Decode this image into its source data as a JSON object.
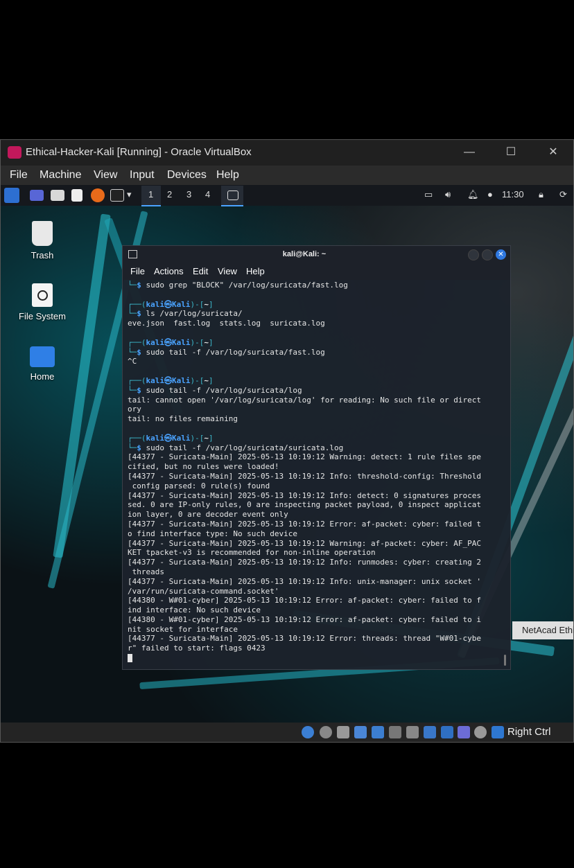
{
  "vbox": {
    "title": "Ethical-Hacker-Kali [Running] - Oracle VirtualBox",
    "menu": [
      "File",
      "Machine",
      "View",
      "Input",
      "Devices",
      "Help"
    ],
    "host_key": "Right Ctrl"
  },
  "panel": {
    "workspaces": [
      "1",
      "2",
      "3",
      "4"
    ],
    "clock": "11:30"
  },
  "desktop": {
    "icons": [
      {
        "label": "Trash",
        "icon": "trash-icon"
      },
      {
        "label": "File System",
        "icon": "drive-icon"
      },
      {
        "label": "Home",
        "icon": "home-folder-icon"
      }
    ],
    "background_text": "NetAcad Ethi"
  },
  "terminal": {
    "title": "kali@Kali: ~",
    "menu": [
      "File",
      "Actions",
      "Edit",
      "View",
      "Help"
    ],
    "prompt_user": "kali",
    "prompt_at": "㉿",
    "prompt_host": "Kali",
    "prompt_dir": "~",
    "lines": [
      {
        "t": "cmd",
        "text": "sudo grep \"BLOCK\" /var/log/suricata/fast.log"
      },
      {
        "t": "blank",
        "text": ""
      },
      {
        "t": "prompt",
        "text": ""
      },
      {
        "t": "cmd",
        "text": "ls /var/log/suricata/"
      },
      {
        "t": "out",
        "text": "eve.json  fast.log  stats.log  suricata.log"
      },
      {
        "t": "blank",
        "text": ""
      },
      {
        "t": "prompt",
        "text": ""
      },
      {
        "t": "cmd",
        "text": "sudo tail -f /var/log/suricata/fast.log"
      },
      {
        "t": "out",
        "text": "^C"
      },
      {
        "t": "blank",
        "text": ""
      },
      {
        "t": "prompt",
        "text": ""
      },
      {
        "t": "cmd",
        "text": "sudo tail -f /var/log/suricata/log"
      },
      {
        "t": "out",
        "text": "tail: cannot open '/var/log/suricata/log' for reading: No such file or direct"
      },
      {
        "t": "out",
        "text": "ory"
      },
      {
        "t": "out",
        "text": "tail: no files remaining"
      },
      {
        "t": "blank",
        "text": ""
      },
      {
        "t": "prompt",
        "text": ""
      },
      {
        "t": "cmd",
        "text": "sudo tail -f /var/log/suricata/suricata.log"
      },
      {
        "t": "out",
        "text": "[44377 - Suricata-Main] 2025-05-13 10:19:12 Warning: detect: 1 rule files spe"
      },
      {
        "t": "out",
        "text": "cified, but no rules were loaded!"
      },
      {
        "t": "out",
        "text": "[44377 - Suricata-Main] 2025-05-13 10:19:12 Info: threshold-config: Threshold"
      },
      {
        "t": "out",
        "text": " config parsed: 0 rule(s) found"
      },
      {
        "t": "out",
        "text": "[44377 - Suricata-Main] 2025-05-13 10:19:12 Info: detect: 0 signatures proces"
      },
      {
        "t": "out",
        "text": "sed. 0 are IP-only rules, 0 are inspecting packet payload, 0 inspect applicat"
      },
      {
        "t": "out",
        "text": "ion layer, 0 are decoder event only"
      },
      {
        "t": "out",
        "text": "[44377 - Suricata-Main] 2025-05-13 10:19:12 Error: af-packet: cyber: failed t"
      },
      {
        "t": "out",
        "text": "o find interface type: No such device"
      },
      {
        "t": "out",
        "text": "[44377 - Suricata-Main] 2025-05-13 10:19:12 Warning: af-packet: cyber: AF_PAC"
      },
      {
        "t": "out",
        "text": "KET tpacket-v3 is recommended for non-inline operation"
      },
      {
        "t": "out",
        "text": "[44377 - Suricata-Main] 2025-05-13 10:19:12 Info: runmodes: cyber: creating 2"
      },
      {
        "t": "out",
        "text": " threads"
      },
      {
        "t": "out",
        "text": "[44377 - Suricata-Main] 2025-05-13 10:19:12 Info: unix-manager: unix socket '"
      },
      {
        "t": "out",
        "text": "/var/run/suricata-command.socket'"
      },
      {
        "t": "out",
        "text": "[44380 - W#01-cyber] 2025-05-13 10:19:12 Error: af-packet: cyber: failed to f"
      },
      {
        "t": "out",
        "text": "ind interface: No such device"
      },
      {
        "t": "out",
        "text": "[44380 - W#01-cyber] 2025-05-13 10:19:12 Error: af-packet: cyber: failed to i"
      },
      {
        "t": "out",
        "text": "nit socket for interface"
      },
      {
        "t": "out",
        "text": "[44377 - Suricata-Main] 2025-05-13 10:19:12 Error: threads: thread \"W#01-cybe"
      },
      {
        "t": "out",
        "text": "r\" failed to start: flags 0423"
      },
      {
        "t": "cursor",
        "text": ""
      }
    ]
  }
}
